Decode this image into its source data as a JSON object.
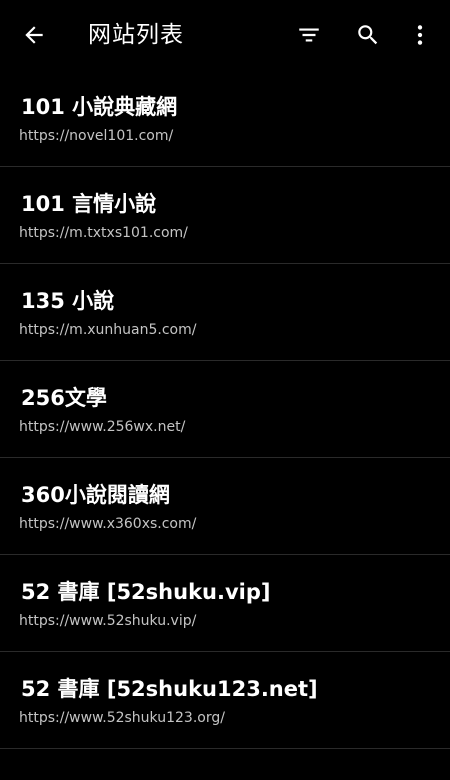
{
  "toolbar": {
    "title": "网站列表",
    "icons": [
      "arrow-back-icon",
      "filter-icon",
      "search-icon",
      "more-vert-icon"
    ]
  },
  "sites": [
    {
      "name": "101 小說典藏網",
      "url": "https://novel101.com/"
    },
    {
      "name": "101 言情小說",
      "url": "https://m.txtxs101.com/"
    },
    {
      "name": "135 小說",
      "url": "https://m.xunhuan5.com/"
    },
    {
      "name": "256文學",
      "url": "https://www.256wx.net/"
    },
    {
      "name": "360小說閱讀網",
      "url": "https://www.x360xs.com/"
    },
    {
      "name": "52 書庫 [52shuku.vip]",
      "url": "https://www.52shuku.vip/"
    },
    {
      "name": "52 書庫 [52shuku123.net]",
      "url": "https://www.52shuku123.org/"
    }
  ],
  "colors": {
    "background": "#000000",
    "primary_text": "#ffffff",
    "secondary_text": "#c4c4c4",
    "divider": "#2a2a2a"
  }
}
